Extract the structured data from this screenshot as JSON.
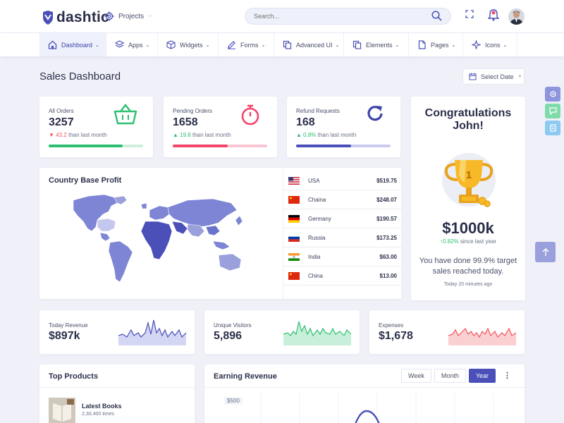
{
  "colors": {
    "accent": "#4a50b8",
    "green": "#2fbf71",
    "pink": "#f2456b",
    "blue": "#3c45a8",
    "red": "#f2545b",
    "map": "#7d85d4"
  },
  "header": {
    "brand": "dashtic",
    "projects_label": "Projects",
    "search_placeholder": "Search..."
  },
  "nav": {
    "items": [
      {
        "label": "Dashboard",
        "icon": "home-icon"
      },
      {
        "label": "Apps",
        "icon": "layers-icon"
      },
      {
        "label": "Widgets",
        "icon": "cube-icon"
      },
      {
        "label": "Forms",
        "icon": "edit-icon"
      },
      {
        "label": "Advanced UI",
        "icon": "copy-icon"
      },
      {
        "label": "Elements",
        "icon": "copy-icon"
      },
      {
        "label": "Pages",
        "icon": "file-icon"
      },
      {
        "label": "Icons",
        "icon": "sparkle-icon"
      }
    ]
  },
  "page": {
    "title": "Sales Dashboard",
    "select_date": "Select Date"
  },
  "stats": [
    {
      "label": "All Orders",
      "value": "3257",
      "change": "43.2",
      "suffix": "than last month",
      "direction": "down",
      "progress": 0.78,
      "color": "#2fbf71",
      "track": "#cfeedd"
    },
    {
      "label": "Pending Orders",
      "value": "1658",
      "change": "19.8",
      "suffix": "than last month",
      "direction": "up",
      "progress": 0.58,
      "color": "#f2456b",
      "track": "#f8c7d3"
    },
    {
      "label": "Refund Requests",
      "value": "168",
      "change": "0.8%",
      "suffix": "than last month",
      "direction": "up",
      "progress": 0.58,
      "color": "#4a50b8",
      "track": "#c9ccef"
    }
  ],
  "country_profit": {
    "title": "Country Base Profit",
    "rows": [
      {
        "country": "USA",
        "value": "$519.75",
        "flag": "us"
      },
      {
        "country": "Chaina",
        "value": "$248.07",
        "flag": "cn"
      },
      {
        "country": "Germany",
        "value": "$190.57",
        "flag": "de"
      },
      {
        "country": "Russia",
        "value": "$173.25",
        "flag": "ru"
      },
      {
        "country": "India",
        "value": "$63.00",
        "flag": "in"
      },
      {
        "country": "China",
        "value": "$13.00",
        "flag": "cn"
      }
    ]
  },
  "congrats": {
    "line1": "Congratulations",
    "line2": "John!",
    "trophy_label": "1",
    "amount": "$1000k",
    "change": "0.82%",
    "since": "since last year",
    "message": "You have done 99.9% target sales reached today.",
    "ago": "Today 20 minutes ago"
  },
  "revenue_cards": [
    {
      "label": "Today Revenue",
      "value": "$897k",
      "color": "#4a50b8",
      "fill": "#d4d7f3"
    },
    {
      "label": "Unique Visitors",
      "value": "5,896",
      "color": "#2fbf71",
      "fill": "#c8efd9"
    },
    {
      "label": "Expenses",
      "value": "$1,678",
      "color": "#f2545b",
      "fill": "#fbd0d2"
    }
  ],
  "top_products": {
    "title": "Top Products",
    "items": [
      {
        "name": "Latest Books",
        "meta": "2,30,400 times"
      }
    ]
  },
  "earning": {
    "title": "Earning Revenue",
    "toggles": [
      "Week",
      "Month",
      "Year"
    ],
    "active": "Year",
    "y_tick": "$500"
  }
}
